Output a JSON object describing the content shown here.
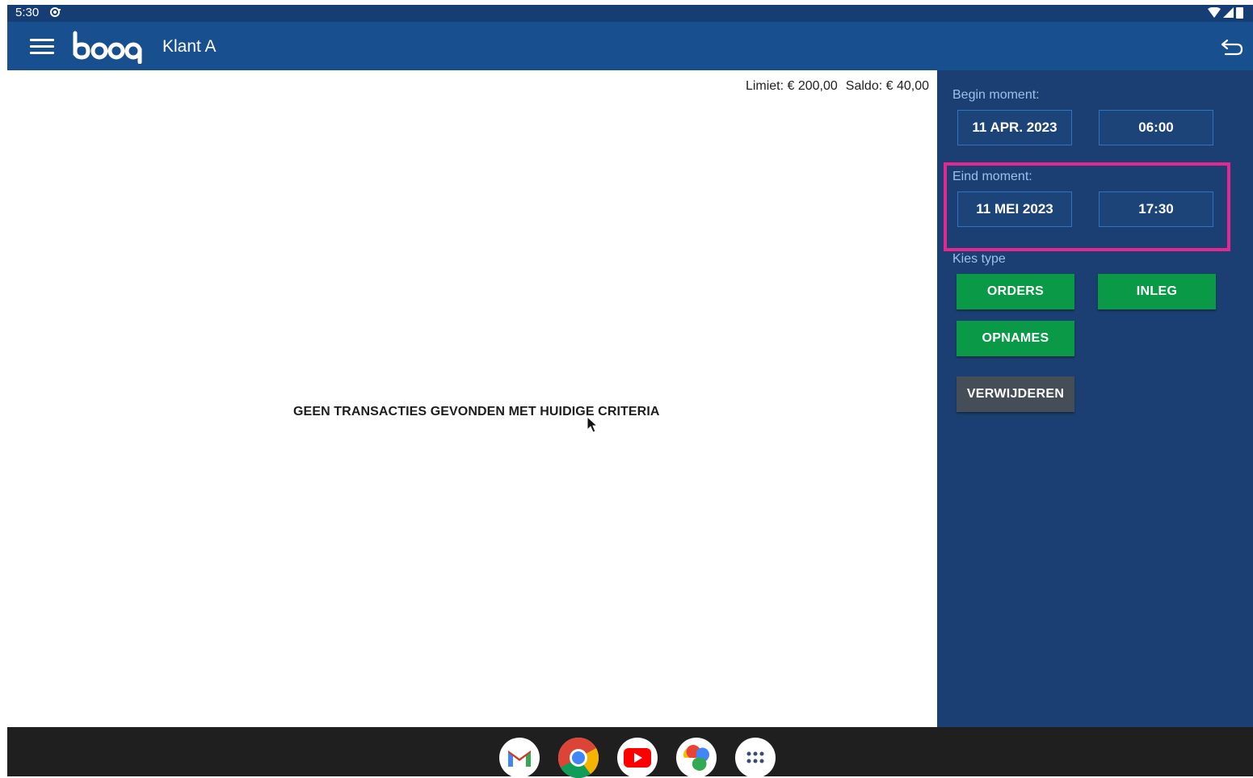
{
  "status_bar": {
    "time": "5:30"
  },
  "app_bar": {
    "logo_text": "booq",
    "title": "Klant A"
  },
  "content": {
    "limit_text": "Limiet: € 200,00",
    "saldo_text": "Saldo: € 40,00",
    "empty_message": "GEEN TRANSACTIES GEVONDEN MET HUIDIGE CRITERIA"
  },
  "filters": {
    "begin": {
      "label": "Begin moment:",
      "date": "11 APR. 2023",
      "time": "06:00"
    },
    "end": {
      "label": "Eind moment:",
      "date": "11 MEI 2023",
      "time": "17:30"
    },
    "type_label": "Kies type",
    "type_buttons": [
      "ORDERS",
      "INLEG",
      "OPNAMES"
    ],
    "delete_label": "VERWIJDEREN"
  },
  "dock": [
    "gmail-icon",
    "chrome-icon",
    "youtube-icon",
    "photos-icon",
    "app-launcher-icon"
  ],
  "colors": {
    "status_bar": "#173e74",
    "app_bar": "#184f8f",
    "side_panel": "#1b3f72",
    "green_button": "#0a9a47",
    "grey_button": "#454d57",
    "highlight": "#e4288f"
  }
}
